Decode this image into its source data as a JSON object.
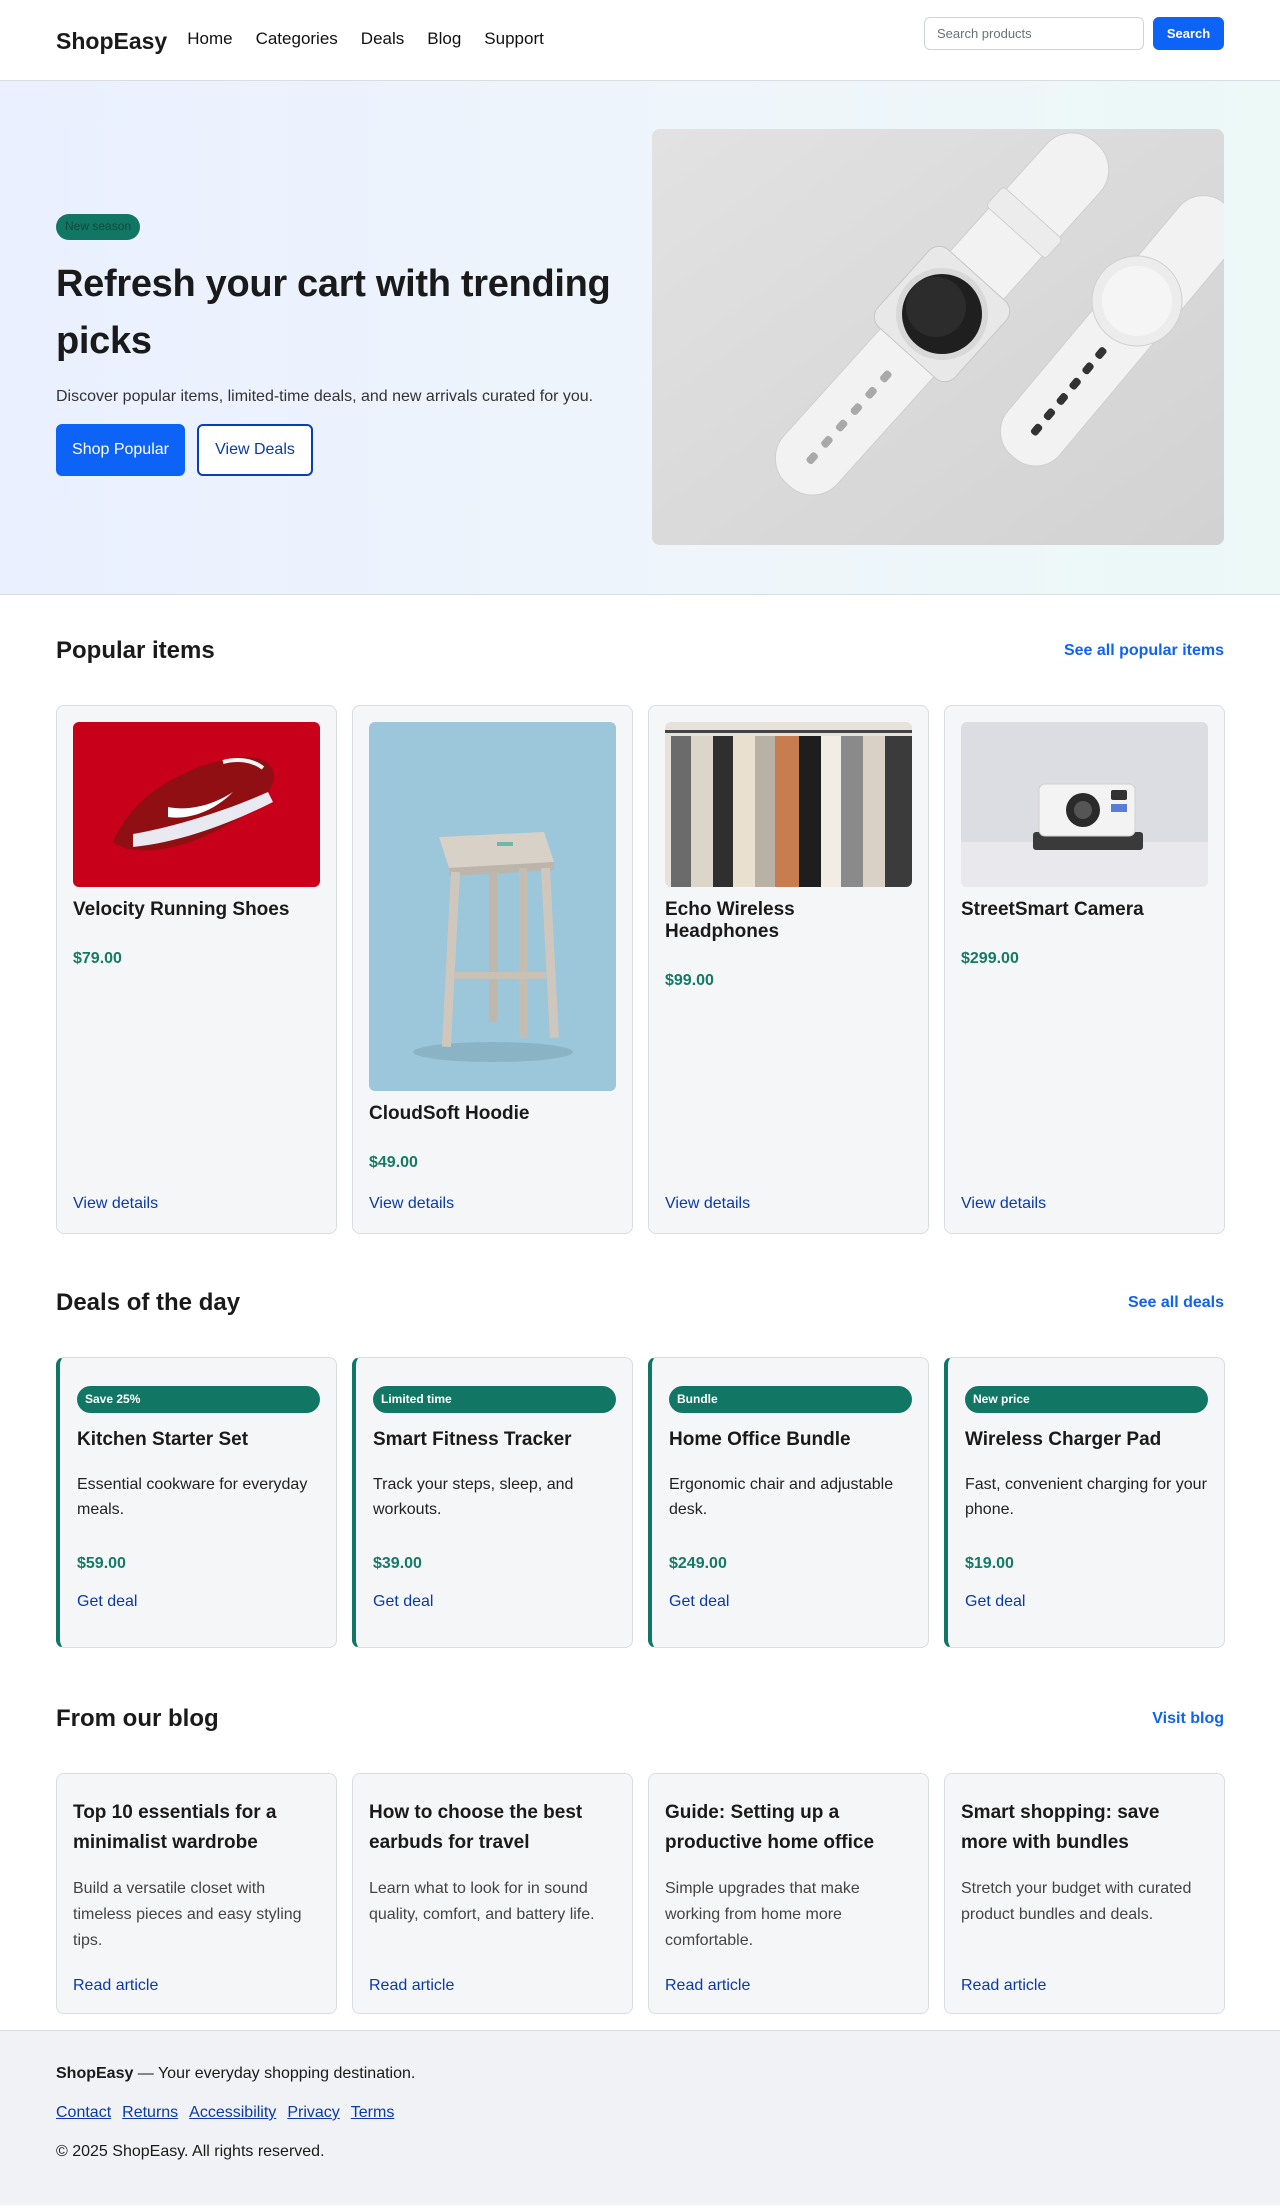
{
  "header": {
    "brand": "ShopEasy",
    "nav": [
      "Home",
      "Categories",
      "Deals",
      "Blog",
      "Support"
    ],
    "search_placeholder": "Search products",
    "search_button": "Search"
  },
  "hero": {
    "badge": "New season",
    "title": "Refresh your cart with trending picks",
    "subtitle": "Discover popular items, limited-time deals, and new arrivals curated for you.",
    "primary_cta": "Shop Popular",
    "secondary_cta": "View Deals"
  },
  "popular": {
    "heading": "Popular items",
    "see_all": "See all popular items",
    "items": [
      {
        "name": "Velocity Running Shoes",
        "price": "$79.00",
        "link": "View details"
      },
      {
        "name": "CloudSoft Hoodie",
        "price": "$49.00",
        "link": "View details"
      },
      {
        "name": "Echo Wireless Headphones",
        "price": "$99.00",
        "link": "View details"
      },
      {
        "name": "StreetSmart Camera",
        "price": "$299.00",
        "link": "View details"
      }
    ]
  },
  "deals": {
    "heading": "Deals of the day",
    "see_all": "See all deals",
    "items": [
      {
        "badge": "Save 25%",
        "title": "Kitchen Starter Set",
        "desc": "Essential cookware for everyday meals.",
        "price": "$59.00",
        "link": "Get deal"
      },
      {
        "badge": "Limited time",
        "title": "Smart Fitness Tracker",
        "desc": "Track your steps, sleep, and workouts.",
        "price": "$39.00",
        "link": "Get deal"
      },
      {
        "badge": "Bundle",
        "title": "Home Office Bundle",
        "desc": "Ergonomic chair and adjustable desk.",
        "price": "$249.00",
        "link": "Get deal"
      },
      {
        "badge": "New price",
        "title": "Wireless Charger Pad",
        "desc": "Fast, convenient charging for your phone.",
        "price": "$19.00",
        "link": "Get deal"
      }
    ]
  },
  "blog": {
    "heading": "From our blog",
    "see_all": "Visit blog",
    "items": [
      {
        "title": "Top 10 essentials for a minimalist wardrobe",
        "desc": "Build a versatile closet with timeless pieces and easy styling tips.",
        "link": "Read article"
      },
      {
        "title": "How to choose the best earbuds for travel",
        "desc": "Learn what to look for in sound quality, comfort, and battery life.",
        "link": "Read article"
      },
      {
        "title": "Guide: Setting up a productive home office",
        "desc": "Simple upgrades that make working from home more comfortable.",
        "link": "Read article"
      },
      {
        "title": "Smart shopping: save more with bundles",
        "desc": "Stretch your budget with curated product bundles and deals.",
        "link": "Read article"
      }
    ]
  },
  "footer": {
    "brand": "ShopEasy",
    "tagline": " — Your everyday shopping destination.",
    "links": [
      "Contact",
      "Returns",
      "Accessibility",
      "Privacy",
      "Terms"
    ],
    "copyright": "© 2025 ShopEasy. All rights reserved."
  },
  "colors": {
    "accent": "#0d63f5",
    "price": "#147a66",
    "deal_badge": "#127664",
    "link": "#0a3aa8"
  }
}
